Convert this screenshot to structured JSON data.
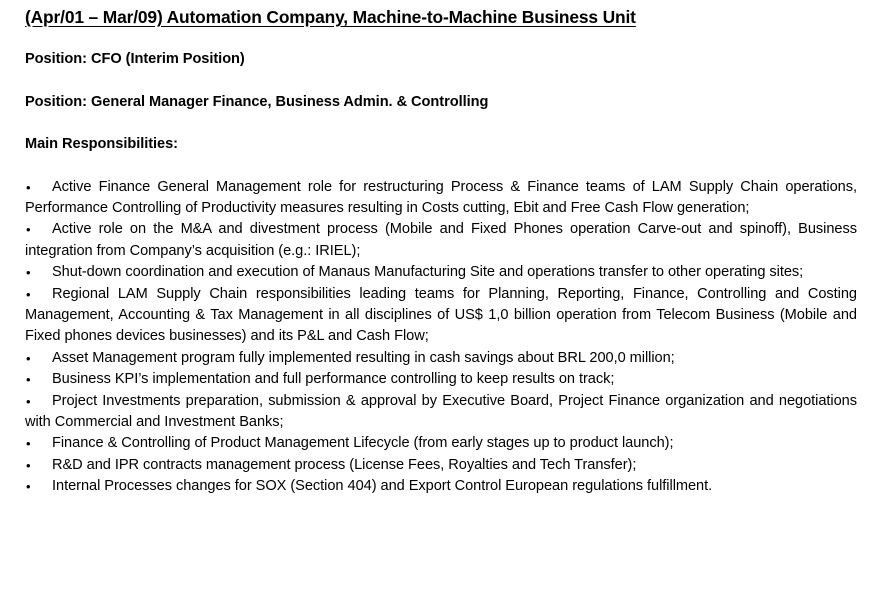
{
  "document": {
    "title": "(Apr/01 – Mar/09) Automation Company, Machine-to-Machine Business Unit",
    "position_interim": "Position: CFO (Interim Position)",
    "position_main": "Position: General Manager Finance, Business Admin. & Controlling",
    "responsibilities_heading": "Main Responsibilities:",
    "bullet_marker": "•",
    "responsibilities": [
      "Active Finance General Management role for restructuring Process & Finance teams of LAM Supply Chain operations, Performance Controlling of Productivity measures resulting in Costs cutting, Ebit and Free Cash Flow generation;",
      "Active role on the M&A and divestment process (Mobile and Fixed Phones operation Carve-out and spinoff), Business integration from Company’s acquisition (e.g.: IRIEL);",
      "Shut-down coordination and execution of Manaus Manufacturing Site and operations transfer to other operating sites;",
      "Regional LAM Supply Chain responsibilities leading teams for Planning, Reporting, Finance, Controlling and Costing Management, Accounting & Tax Management in all disciplines of US$ 1,0 billion operation from Telecom Business (Mobile and Fixed phones devices businesses) and its P&L and Cash Flow;",
      "Asset Management program fully implemented resulting in cash savings about BRL 200,0 million;",
      "Business KPI’s implementation and full performance controlling to keep results on track;",
      "Project Investments preparation, submission & approval by Executive Board, Project Finance organization and negotiations with Commercial and Investment Banks;",
      "Finance & Controlling of Product Management Lifecycle (from early stages up to product launch);",
      "R&D and IPR contracts management process (License Fees, Royalties and Tech Transfer);",
      "Internal Processes changes for SOX (Section 404) and Export Control European regulations fulfillment."
    ]
  },
  "style": {
    "text_color": "#000000",
    "background_color": "#ffffff"
  }
}
